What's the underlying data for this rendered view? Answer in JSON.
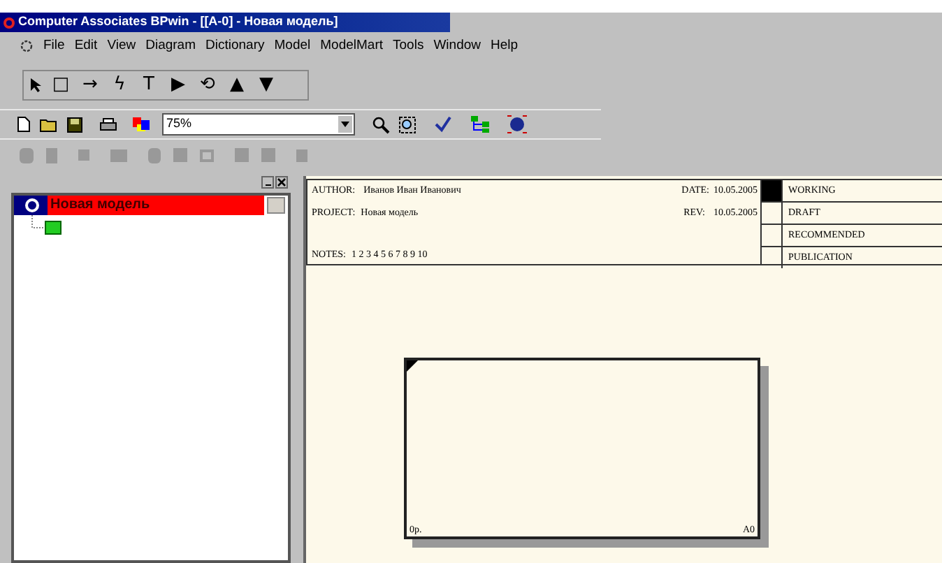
{
  "window": {
    "title": "Computer Associates BPwin - [[A-0]  - Новая модель]"
  },
  "menu": [
    "File",
    "Edit",
    "View",
    "Diagram",
    "Dictionary",
    "Model",
    "ModelMart",
    "Tools",
    "Window",
    "Help"
  ],
  "drawing_tools": [
    "□",
    "→",
    "ϟ",
    "T",
    "▶",
    "⟲",
    "▲",
    "▼"
  ],
  "zoom": {
    "value": "75%"
  },
  "model_tree": {
    "root": "Новая модель",
    "selected": true
  },
  "diagram_header": {
    "author_label": "AUTHOR:",
    "author": "Иванов Иван Иванович",
    "project_label": "PROJECT:",
    "project": "Новая модель",
    "date_label": "DATE:",
    "date": "10.05.2005",
    "rev_label": "REV:",
    "rev": "10.05.2005",
    "notes_label": "NOTES:",
    "notes": "1  2  3  4  5  6  7  8  9  10",
    "statuses": [
      {
        "label": "WORKING",
        "selected": true
      },
      {
        "label": "DRAFT",
        "selected": false
      },
      {
        "label": "RECOMMENDED",
        "selected": false
      },
      {
        "label": "PUBLICATION",
        "selected": false
      }
    ]
  },
  "activity_box": {
    "cost": "0р.",
    "node": "A0"
  }
}
